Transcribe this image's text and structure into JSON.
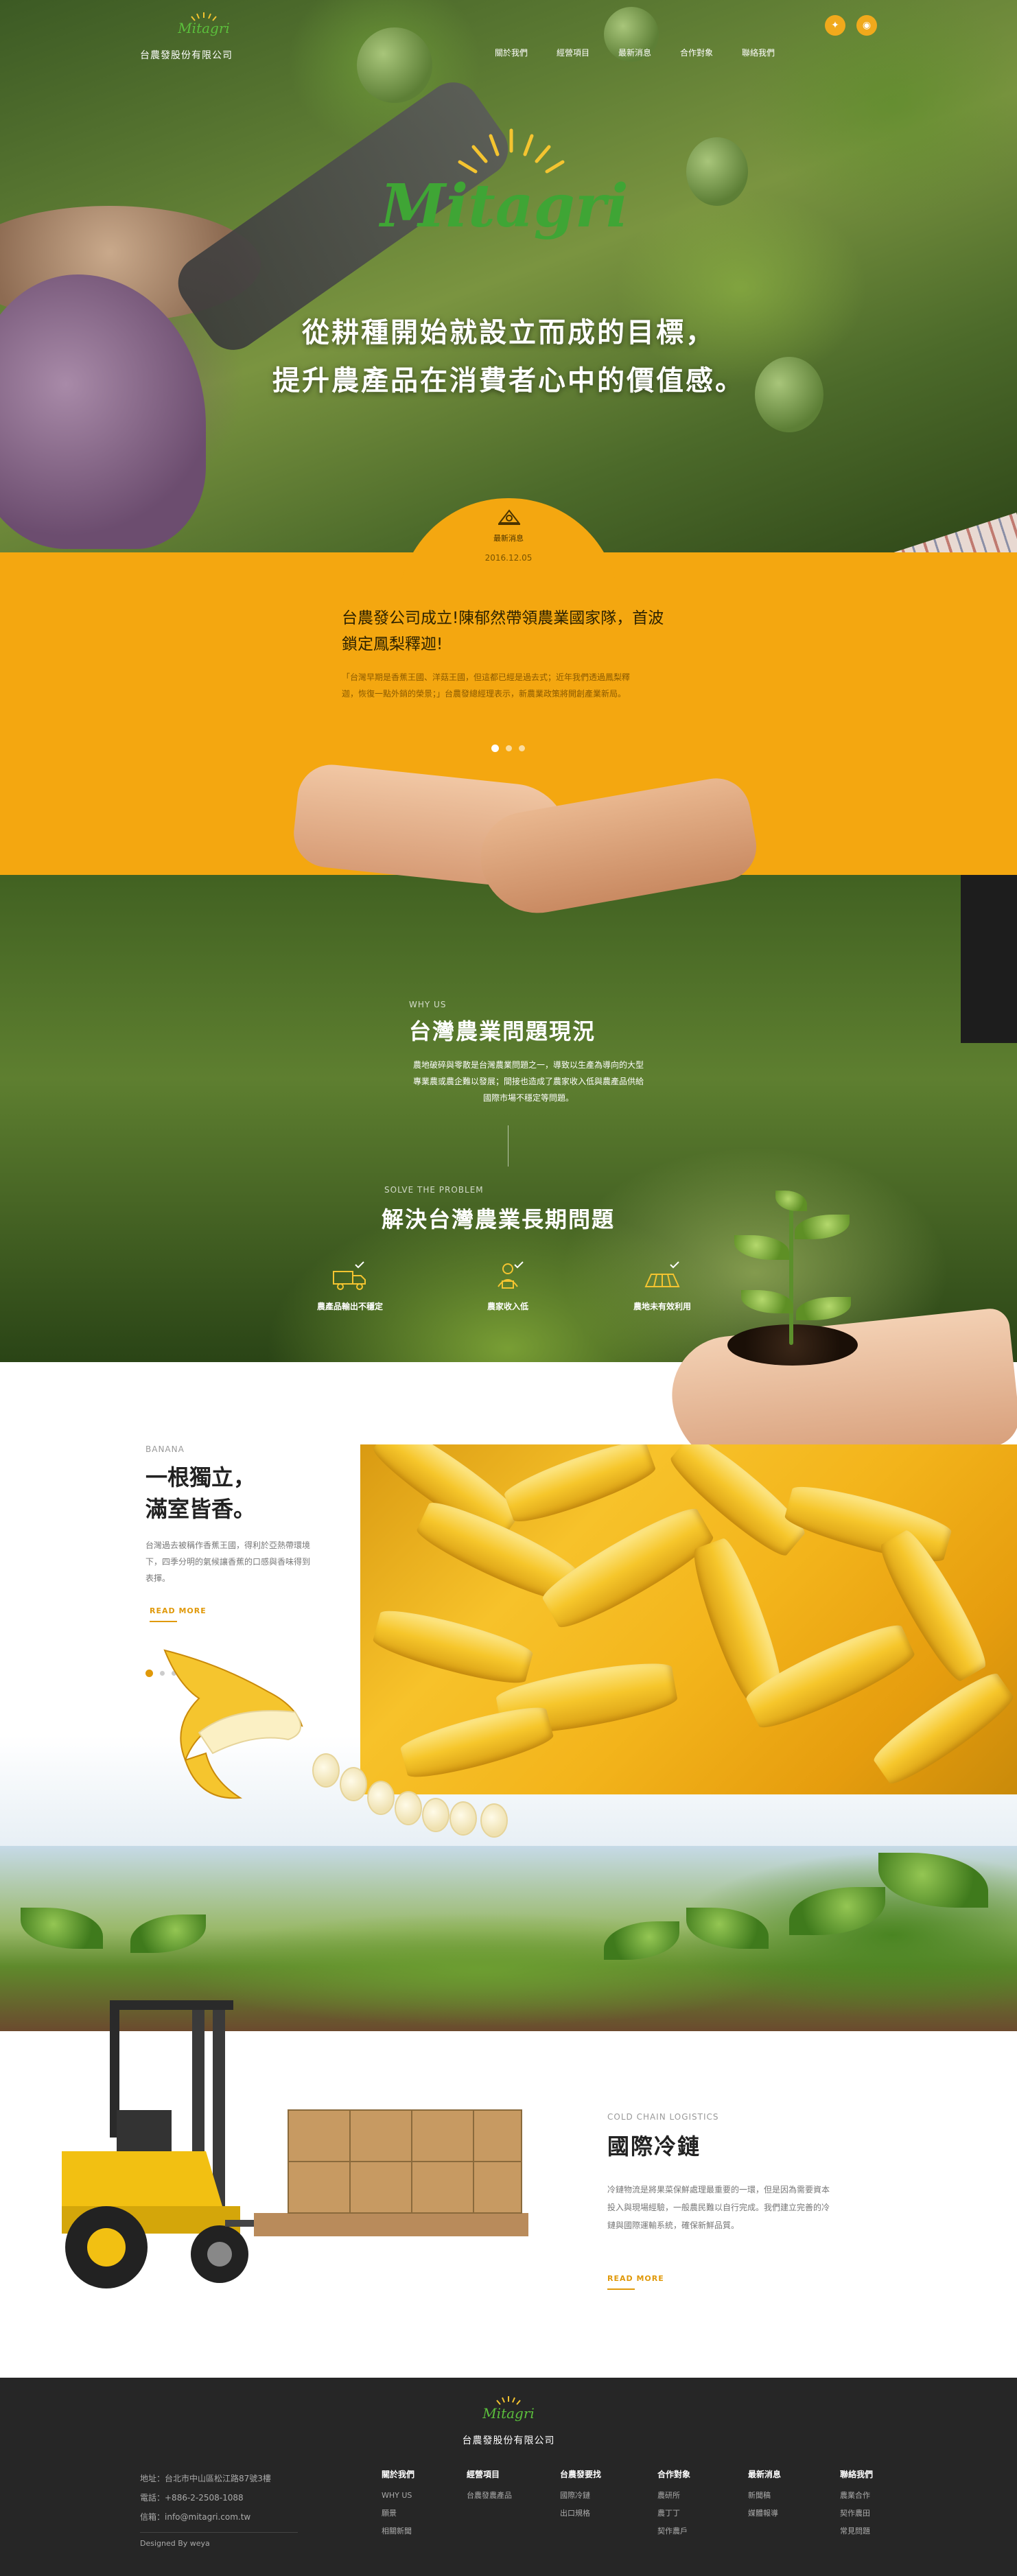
{
  "nav": {
    "logo_text": "Mitagri",
    "company": "台農發股份有限公司",
    "menu": [
      "關於我們",
      "經營項目",
      "最新消息",
      "合作對象",
      "聯絡我們"
    ]
  },
  "hero": {
    "logo_text": "Mitagri",
    "line1": "從耕種開始就設立而成的目標，",
    "line2": "提升農產品在消費者心中的價值感。"
  },
  "news": {
    "label": "最新消息",
    "date": "2016.12.05",
    "title": "台農發公司成立!陳郁然帶領農業國家隊，首波鎖定鳳梨釋迦!",
    "body": "「台灣早期是香蕉王國、洋菇王國，但這都已經是過去式；近年我們透過鳳梨釋迦，恢復一點外銷的榮景；」台農發總經理表示，新農業政策將開創產業新局。"
  },
  "why": {
    "kicker": "WHY US",
    "title": "台灣農業問題現況",
    "text": "農地破碎與零散是台灣農業問題之一，導致以生產為導向的大型專業農或農企難以發展；間接也造成了農家收入低與農產品供給國際市場不穩定等問題。"
  },
  "solve": {
    "kicker": "SOLVE THE PROBLEM",
    "title": "解決台灣農業長期問題",
    "features": [
      "農產品輸出不穩定",
      "農家收入低",
      "農地未有效利用"
    ]
  },
  "banana": {
    "kicker": "BANANA",
    "title_line1": "一根獨立，",
    "title_line2": "滿室皆香。",
    "text": "台灣過去被稱作香蕉王國，得利於亞熱帶環境下，四季分明的氣候讓香蕉的口感與香味得到表揮。",
    "read_more": "READ MORE"
  },
  "cold": {
    "kicker": "COLD CHAIN LOGISTICS",
    "title": "國際冷鏈",
    "text": "冷鏈物流是將果菜保鮮處理最重要的一環，但是因為需要資本投入與現場經驗，一般農民難以自行完成。我們建立完善的冷鏈與國際運輸系統，確保新鮮品質。",
    "read_more": "READ MORE"
  },
  "footer": {
    "logo_text": "Mitagri",
    "company": "台農發股份有限公司",
    "address": "地址：台北市中山區松江路87號3樓",
    "phone": "電話：+886-2-2508-1088",
    "email": "信箱：info@mitagri.com.tw",
    "designed_by": "Designed By weya",
    "columns": [
      {
        "title": "關於我們",
        "items": [
          "WHY US",
          "願景",
          "相關新聞"
        ]
      },
      {
        "title": "經營項目",
        "items": [
          "台農發農產品"
        ]
      },
      {
        "title": "台農發要找",
        "items": [
          "國際冷鏈",
          "出口規格"
        ]
      },
      {
        "title": "合作對象",
        "items": [
          "農研所",
          "農丁丁",
          "契作農戶"
        ]
      },
      {
        "title": "最新消息",
        "items": [
          "新聞稿",
          "媒體報導"
        ]
      },
      {
        "title": "聯絡我們",
        "items": [
          "農業合作",
          "契作農田",
          "常見問題"
        ]
      }
    ]
  },
  "colors": {
    "accent": "#f4a710",
    "logo_green": "#3fa535",
    "footer_bg": "#262626"
  },
  "icons": [
    "twitter-icon",
    "rss-icon",
    "news-badge-icon",
    "truck-icon",
    "farmer-income-icon",
    "farmland-icon"
  ]
}
